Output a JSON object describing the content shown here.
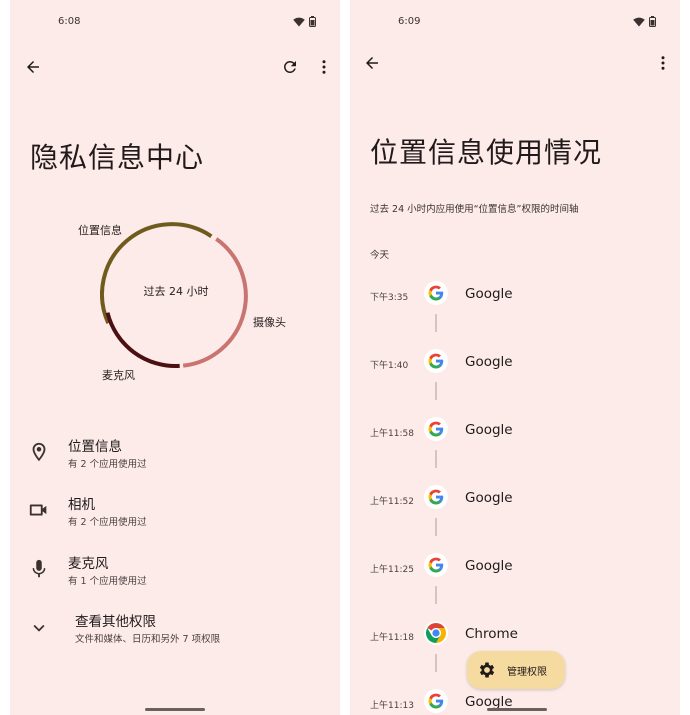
{
  "left": {
    "status": {
      "time": "6:08"
    },
    "title": "隐私信息中心",
    "ring": {
      "center_label": "过去 24 小时",
      "segments": [
        {
          "label": "位置信息",
          "color": "#6f5b1e"
        },
        {
          "label": "摄像头",
          "color": "#c97470"
        },
        {
          "label": "麦克风",
          "color": "#4a1014"
        }
      ]
    },
    "permissions": [
      {
        "icon": "location-pin-icon",
        "title": "位置信息",
        "subtitle": "有 2 个应用使用过"
      },
      {
        "icon": "videocam-icon",
        "title": "相机",
        "subtitle": "有 2 个应用使用过"
      },
      {
        "icon": "microphone-icon",
        "title": "麦克风",
        "subtitle": "有 1 个应用使用过"
      }
    ],
    "more": {
      "icon": "chevron-down-icon",
      "title": "查看其他权限",
      "subtitle": "文件和媒体、日历和另外 7 项权限"
    }
  },
  "right": {
    "status": {
      "time": "6:09"
    },
    "title": "位置信息使用情况",
    "description": "过去 24 小时内应用使用“位置信息”权限的时间轴",
    "day_label": "今天",
    "timeline": [
      {
        "time": "下午3:35",
        "app": "Google",
        "icon": "google-g-icon"
      },
      {
        "time": "下午1:40",
        "app": "Google",
        "icon": "google-g-icon"
      },
      {
        "time": "上午11:58",
        "app": "Google",
        "icon": "google-g-icon"
      },
      {
        "time": "上午11:52",
        "app": "Google",
        "icon": "google-g-icon"
      },
      {
        "time": "上午11:25",
        "app": "Google",
        "icon": "google-g-icon"
      },
      {
        "time": "上午11:18",
        "app": "Chrome",
        "icon": "chrome-icon"
      },
      {
        "time": "上午11:13",
        "app": "Google",
        "icon": "google-g-icon"
      }
    ],
    "fab": {
      "icon": "gear-icon",
      "label": "管理权限"
    }
  },
  "colors": {
    "background": "#fcebe9",
    "fab": "#f6dba0",
    "accent_location": "#6f5b1e",
    "accent_camera": "#c97470",
    "accent_microphone": "#4a1014"
  }
}
